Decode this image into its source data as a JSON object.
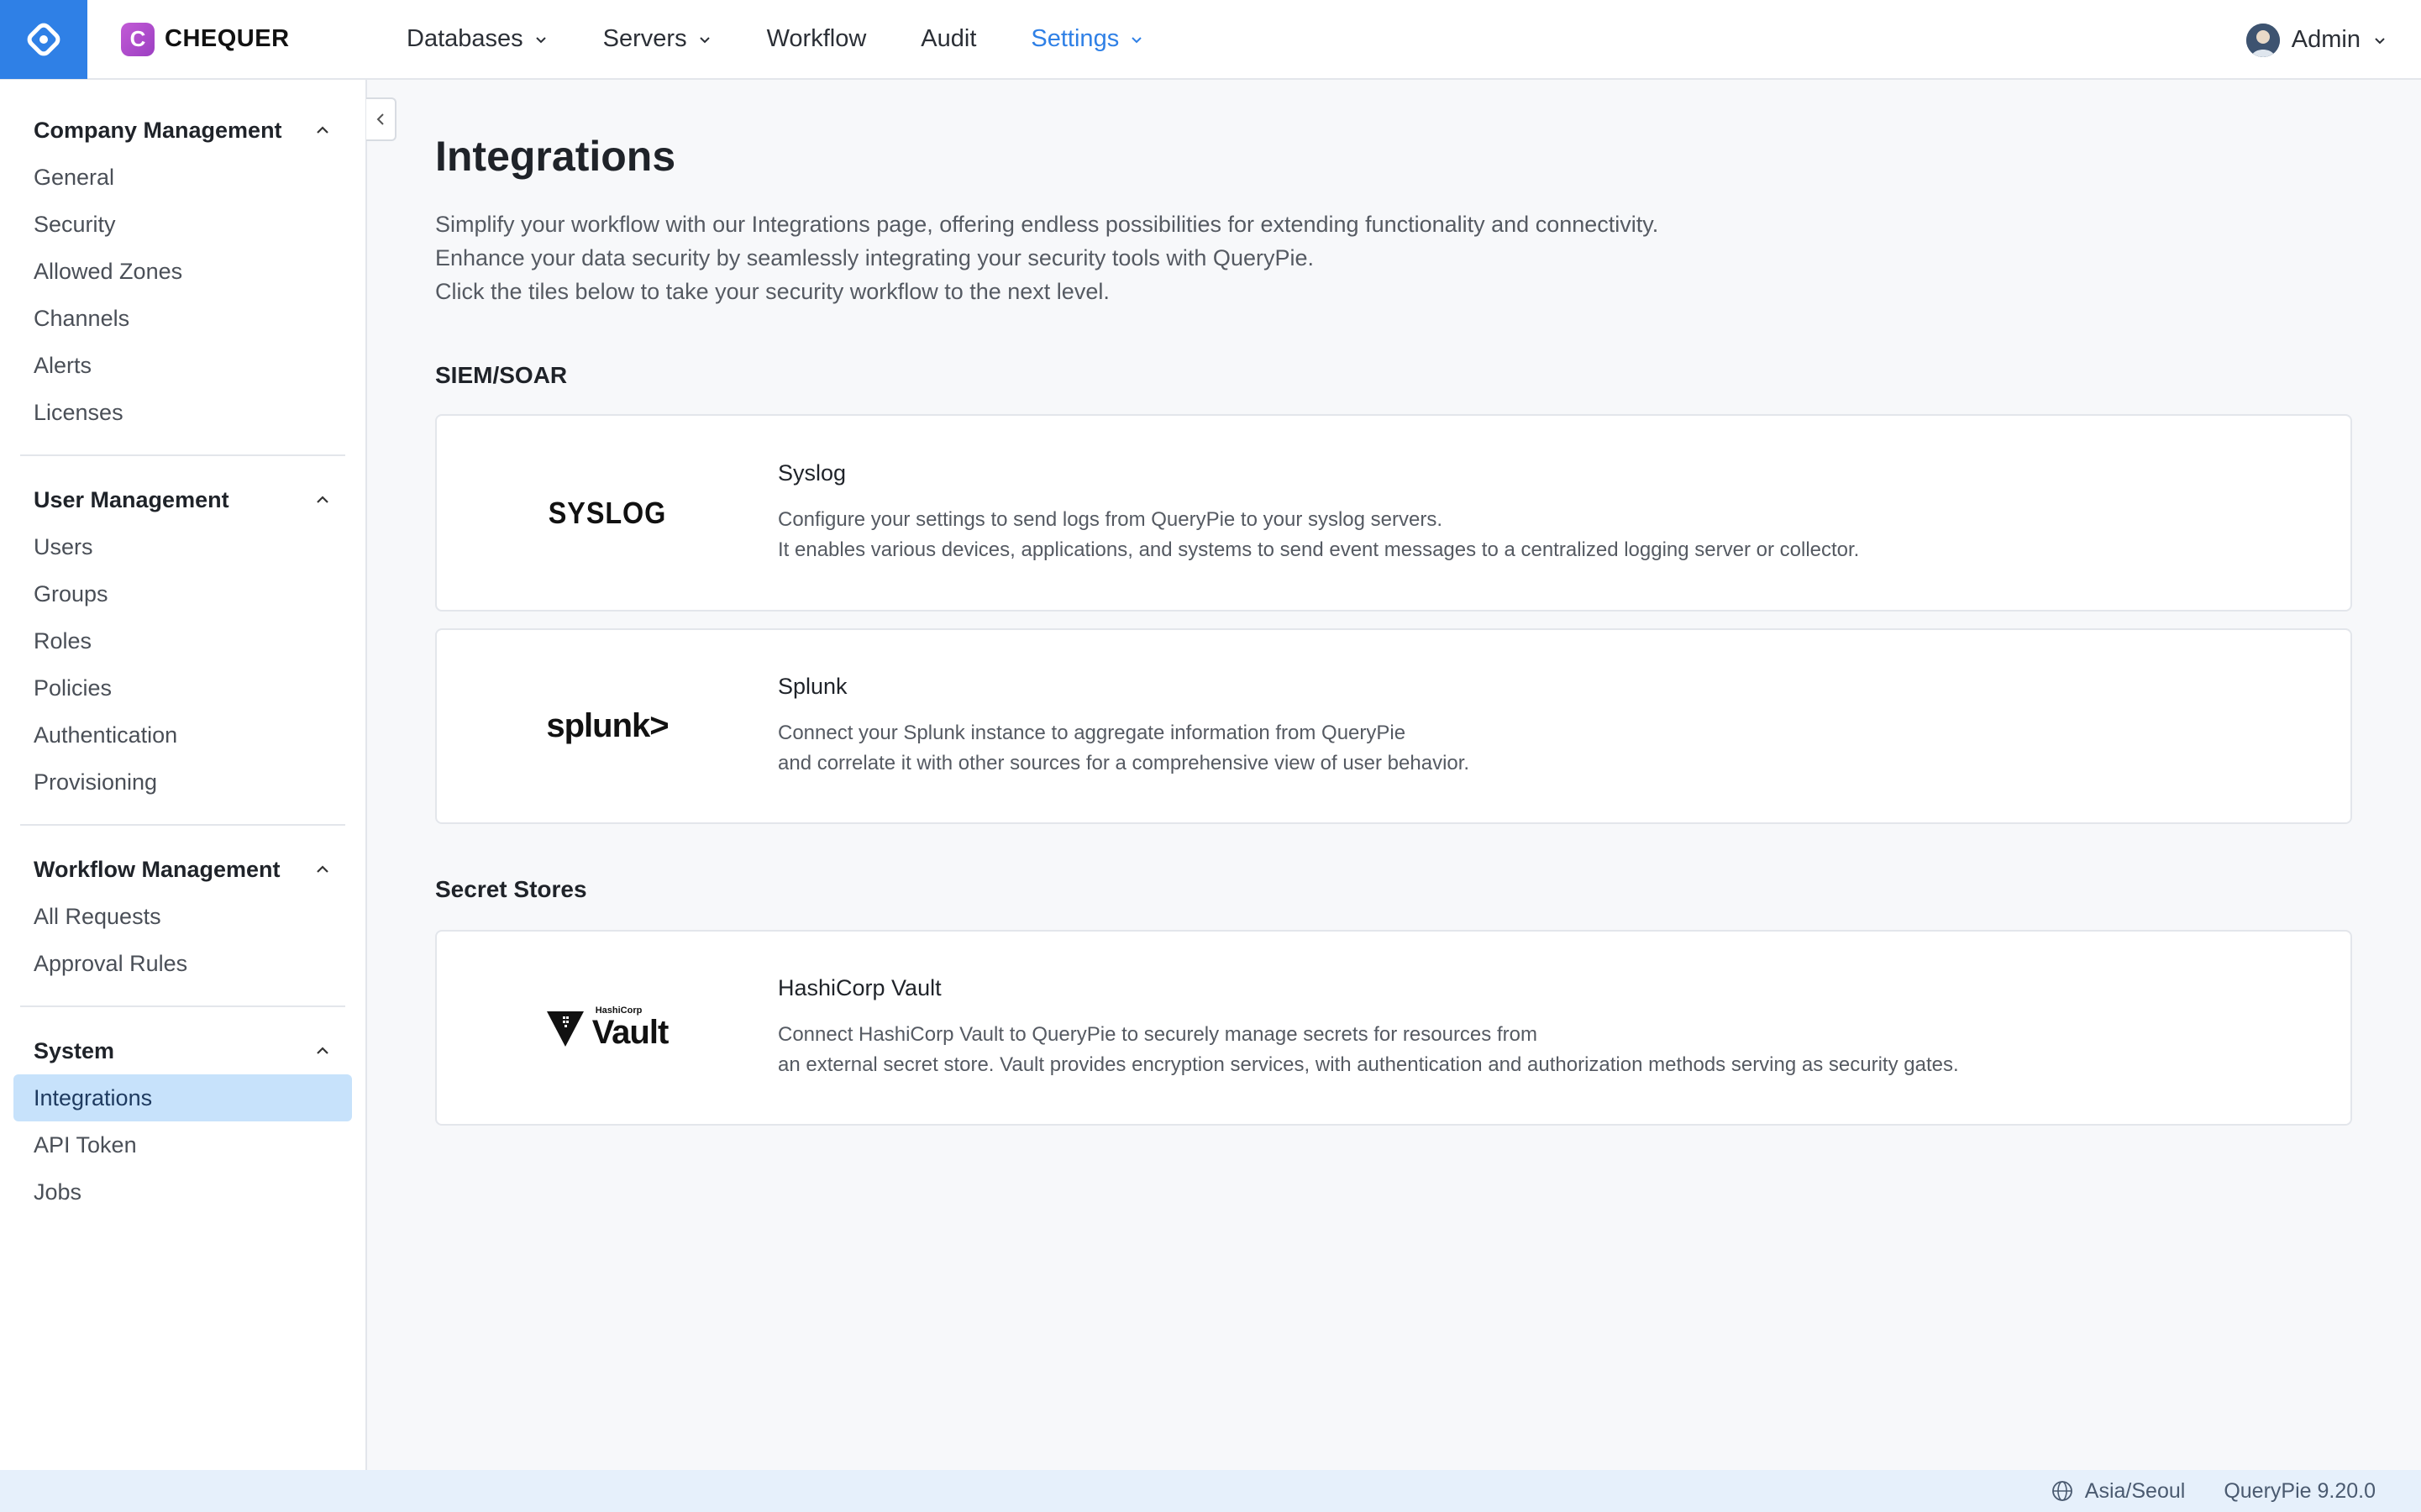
{
  "topbar": {
    "brand_mark": "C",
    "brand_name": "CHEQUER",
    "nav": [
      {
        "label": "Databases",
        "has_dropdown": true,
        "active": false
      },
      {
        "label": "Servers",
        "has_dropdown": true,
        "active": false
      },
      {
        "label": "Workflow",
        "has_dropdown": false,
        "active": false
      },
      {
        "label": "Audit",
        "has_dropdown": false,
        "active": false
      },
      {
        "label": "Settings",
        "has_dropdown": true,
        "active": true
      }
    ],
    "user_name": "Admin"
  },
  "sidebar": {
    "groups": [
      {
        "title": "Company Management",
        "items": [
          "General",
          "Security",
          "Allowed Zones",
          "Channels",
          "Alerts",
          "Licenses"
        ]
      },
      {
        "title": "User Management",
        "items": [
          "Users",
          "Groups",
          "Roles",
          "Policies",
          "Authentication",
          "Provisioning"
        ]
      },
      {
        "title": "Workflow Management",
        "items": [
          "All Requests",
          "Approval Rules"
        ]
      },
      {
        "title": "System",
        "items": [
          "Integrations",
          "API Token",
          "Jobs"
        ]
      }
    ],
    "active_item": "Integrations"
  },
  "main": {
    "title": "Integrations",
    "intro": [
      "Simplify your workflow with our Integrations page, offering endless possibilities for extending functionality and connectivity.",
      "Enhance your data security by seamlessly integrating your security tools with QueryPie.",
      "Click the tiles below to take your security workflow to the next level."
    ],
    "sections": [
      {
        "title": "SIEM/SOAR",
        "tiles": [
          {
            "logo": "SYSLOG",
            "name": "Syslog",
            "desc": [
              "Configure your settings to send logs from QueryPie to your syslog servers.",
              "It enables various devices, applications, and systems to send event messages to a centralized logging server or collector."
            ]
          },
          {
            "logo": "splunk>",
            "name": "Splunk",
            "desc": [
              "Connect your Splunk instance to aggregate information from QueryPie",
              "and correlate it with other sources for a comprehensive view of user behavior."
            ]
          }
        ]
      },
      {
        "title": "Secret Stores",
        "tiles": [
          {
            "logo_small": "HashiCorp",
            "logo": "Vault",
            "name": "HashiCorp Vault",
            "desc": [
              "Connect HashiCorp Vault to QueryPie to securely manage secrets for resources from",
              "an external secret store. Vault provides encryption services, with authentication and authorization methods serving as security gates."
            ]
          }
        ]
      }
    ]
  },
  "footer": {
    "timezone": "Asia/Seoul",
    "version": "QueryPie 9.20.0"
  },
  "colors": {
    "accent": "#2f80e6",
    "active_item_bg": "#c7e2fb",
    "brand_mark": "#b34fcb",
    "footer_bg": "#e6f0fb"
  },
  "icons": [
    "querypie-home-icon",
    "chevron-down-icon",
    "chevron-up-icon",
    "chevron-left-icon",
    "globe-icon",
    "vault-triangle-icon"
  ]
}
